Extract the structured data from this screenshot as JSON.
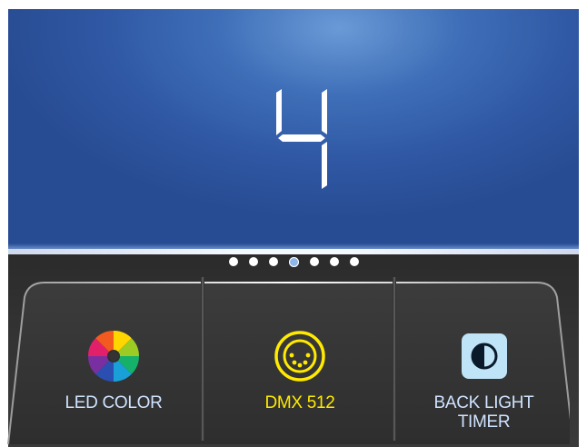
{
  "display": {
    "value": "4"
  },
  "pager": {
    "count": 7,
    "active_index": 3
  },
  "buttons": [
    {
      "label": "LED COLOR",
      "icon": "color-wheel-icon"
    },
    {
      "label": "DMX 512",
      "icon": "dmx-connector-icon"
    },
    {
      "label_line1": "BACK LIGHT",
      "label_line2": "TIMER",
      "icon": "contrast-icon"
    }
  ],
  "colors": {
    "screen": "#2f57a3",
    "panel": "#333333",
    "label_default": "#cfe3ff",
    "label_selected": "#ffea00",
    "page_dot_active": "#8fb6ea"
  }
}
